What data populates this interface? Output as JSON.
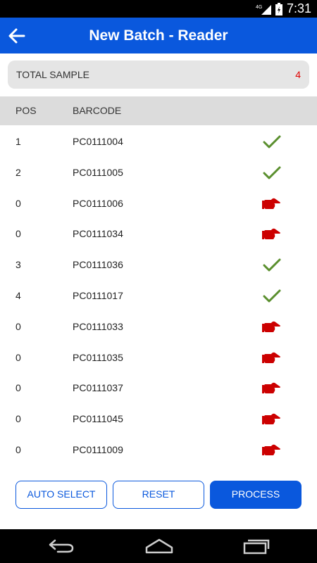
{
  "status_bar": {
    "time": "7:31",
    "network": "4G"
  },
  "app_bar": {
    "title": "New Batch - Reader"
  },
  "summary": {
    "label": "TOTAL SAMPLE",
    "count": "4"
  },
  "table": {
    "headers": {
      "pos": "POS",
      "barcode": "BARCODE"
    },
    "rows": [
      {
        "pos": "1",
        "barcode": "PC0111004",
        "status": "check-icon"
      },
      {
        "pos": "2",
        "barcode": "PC0111005",
        "status": "check-icon"
      },
      {
        "pos": "0",
        "barcode": "PC0111006",
        "status": "pointing-hand-icon"
      },
      {
        "pos": "0",
        "barcode": "PC0111034",
        "status": "pointing-hand-icon"
      },
      {
        "pos": "3",
        "barcode": "PC0111036",
        "status": "check-icon"
      },
      {
        "pos": "4",
        "barcode": "PC0111017",
        "status": "check-icon"
      },
      {
        "pos": "0",
        "barcode": "PC0111033",
        "status": "pointing-hand-icon"
      },
      {
        "pos": "0",
        "barcode": "PC0111035",
        "status": "pointing-hand-icon"
      },
      {
        "pos": "0",
        "barcode": "PC0111037",
        "status": "pointing-hand-icon"
      },
      {
        "pos": "0",
        "barcode": "PC0111045",
        "status": "pointing-hand-icon"
      },
      {
        "pos": "0",
        "barcode": "PC0111009",
        "status": "pointing-hand-icon"
      }
    ]
  },
  "buttons": {
    "auto_select": "AUTO SELECT",
    "reset": "RESET",
    "process": "PROCESS"
  },
  "colors": {
    "primary": "#0a58dd",
    "success": "#5a8f2e",
    "error": "#cc0000",
    "count": "#e00000"
  }
}
